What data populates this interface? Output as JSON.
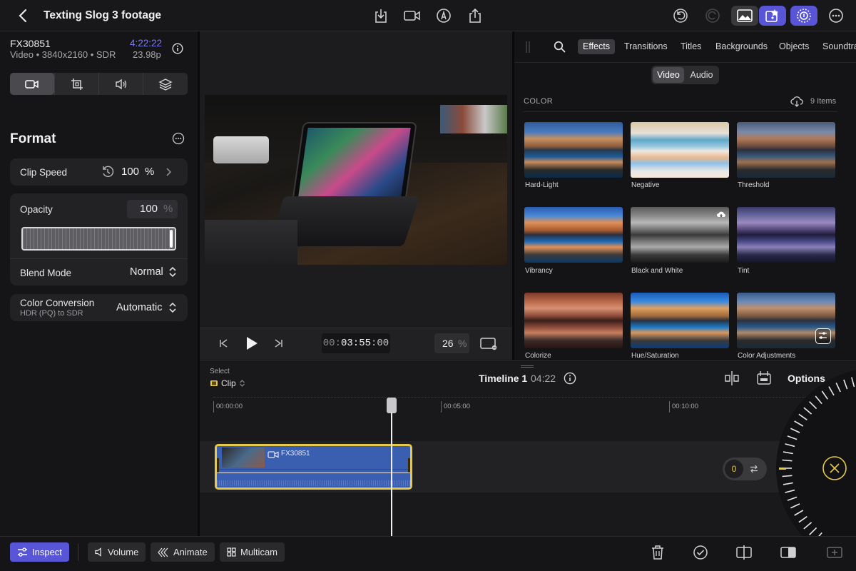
{
  "header": {
    "back_icon": "chevron-left-icon",
    "project_title": "Texting Slog 3 footage",
    "toolbar_icons": [
      "import-icon",
      "camera-icon",
      "pencil-icon",
      "share-icon"
    ],
    "right_icons": [
      "undo-icon",
      "redo-icon",
      "photos-icon",
      "browser-icon",
      "inspector-icon",
      "more-icon"
    ]
  },
  "inspector": {
    "clip_name": "FX30851",
    "clip_meta": "Video • 3840x2160 • SDR",
    "clip_duration": "4:22:22",
    "clip_framerate": "23.98p",
    "tabs": [
      "video-tab",
      "crop-tab",
      "audio-tab",
      "layers-tab"
    ],
    "section_title": "Format",
    "clip_speed": {
      "label": "Clip Speed",
      "value": "100",
      "unit": "%"
    },
    "opacity": {
      "label": "Opacity",
      "value": "100",
      "unit": "%",
      "level": 1.0
    },
    "blend_mode": {
      "label": "Blend Mode",
      "value": "Normal"
    },
    "color_conversion": {
      "label": "Color Conversion",
      "sub": "HDR (PQ) to SDR",
      "value": "Automatic"
    }
  },
  "viewer": {
    "timecode_dim": "00:",
    "timecode_main": "03:55",
    "timecode_frames": ":00",
    "zoom_value": "26",
    "zoom_unit": "%"
  },
  "browser": {
    "tabs": [
      "Effects",
      "Transitions",
      "Titles",
      "Backgrounds",
      "Objects",
      "Soundtra"
    ],
    "active_tab": "Effects",
    "segments": [
      "Video",
      "Audio"
    ],
    "category": "COLOR",
    "item_count": "9 Items",
    "effects": [
      "Hard-Light",
      "Negative",
      "Threshold",
      "Vibrancy",
      "Black and White",
      "Tint",
      "Colorize",
      "Hue/Saturation",
      "Color Adjustments"
    ]
  },
  "timeline": {
    "select_label": "Select",
    "select_value": "Clip",
    "title": "Timeline 1",
    "duration": "04:22",
    "options_label": "Options",
    "ruler": [
      "00:00:00",
      "00:05:00",
      "00:10:00"
    ],
    "clip_name": "FX30851",
    "jog_value": "0"
  },
  "bottombar": {
    "inspect": "Inspect",
    "volume": "Volume",
    "animate": "Animate",
    "multicam": "Multicam",
    "action_icons": [
      "trash-icon",
      "checkmark-icon",
      "split-icon",
      "detach-icon",
      "edit-icon"
    ]
  },
  "colors": {
    "accent": "#5856d6",
    "clip_blue": "#3b5fb0",
    "clip_border": "#e6c84a"
  }
}
